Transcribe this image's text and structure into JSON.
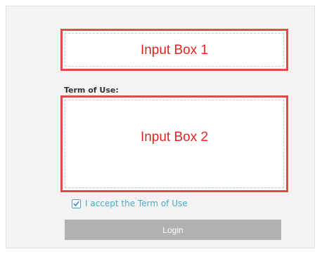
{
  "input_box_1": {
    "label": "Input Box 1"
  },
  "terms": {
    "heading": "Term of Use:"
  },
  "input_box_2": {
    "label": "Input Box 2"
  },
  "accept": {
    "label": "I accept the Term of Use",
    "checked": true
  },
  "login": {
    "label": "Login"
  },
  "colors": {
    "highlight_border": "#e24b47",
    "annotation_text": "#e52420",
    "link_text": "#43aec9",
    "button_bg": "#b1b1b1",
    "panel_bg": "#f3f3f3"
  },
  "icons": {
    "checkbox": "check-icon"
  }
}
